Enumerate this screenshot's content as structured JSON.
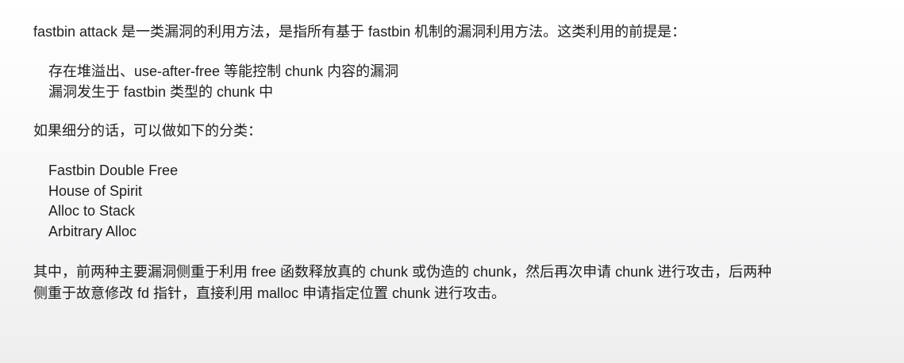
{
  "intro": "fastbin attack 是一类漏洞的利用方法，是指所有基于 fastbin 机制的漏洞利用方法。这类利用的前提是：",
  "prerequisites": [
    "存在堆溢出、use-after-free 等能控制 chunk 内容的漏洞",
    "漏洞发生于 fastbin 类型的 chunk 中"
  ],
  "classification_intro": "如果细分的话，可以做如下的分类：",
  "categories": [
    "Fastbin Double Free",
    "House of Spirit",
    "Alloc to Stack",
    "Arbitrary Alloc"
  ],
  "conclusion": [
    "其中，前两种主要漏洞侧重于利用 free 函数释放真的 chunk 或伪造的 chunk，然后再次申请 chunk 进行攻击，后两种",
    "侧重于故意修改 fd 指针，直接利用 malloc 申请指定位置 chunk 进行攻击。"
  ]
}
